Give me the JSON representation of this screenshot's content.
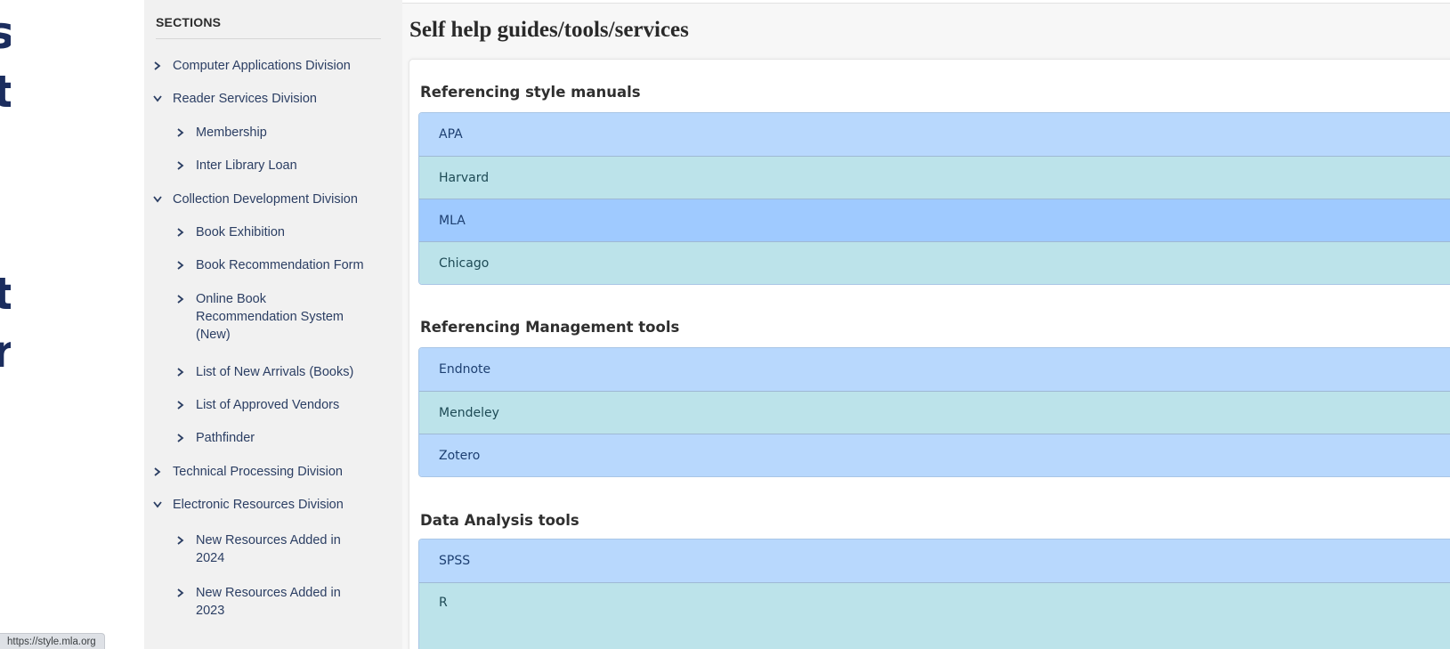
{
  "page": {
    "title": "Self help guides/tools/services"
  },
  "left_edge": {
    "glyphs": [
      "s",
      "t",
      "t",
      "r"
    ]
  },
  "sidebar": {
    "heading": "SECTIONS",
    "items": [
      {
        "label": "Computer Applications Division",
        "expanded": false,
        "level": 0
      },
      {
        "label": "Reader Services Division",
        "expanded": true,
        "level": 0
      },
      {
        "label": "Membership",
        "expanded": false,
        "level": 1
      },
      {
        "label": "Inter Library Loan",
        "expanded": false,
        "level": 1
      },
      {
        "label": "Collection Development Division",
        "expanded": true,
        "level": 0
      },
      {
        "label": "Book Exhibition",
        "expanded": false,
        "level": 1
      },
      {
        "label": "Book Recommendation Form",
        "expanded": false,
        "level": 1
      },
      {
        "label": "Online Book Recommendation System (New)",
        "expanded": false,
        "level": 1
      },
      {
        "label": "List of New Arrivals (Books)",
        "expanded": false,
        "level": 1
      },
      {
        "label": "List of Approved Vendors",
        "expanded": false,
        "level": 1
      },
      {
        "label": "Pathfinder",
        "expanded": false,
        "level": 1
      },
      {
        "label": "Technical Processing Division",
        "expanded": false,
        "level": 0
      },
      {
        "label": "Electronic Resources Division",
        "expanded": true,
        "level": 0
      },
      {
        "label": "New Resources Added in 2024",
        "expanded": false,
        "level": 1
      },
      {
        "label": "New Resources Added in 2023",
        "expanded": false,
        "level": 1
      }
    ]
  },
  "groups": [
    {
      "title": "Referencing style manuals",
      "items": [
        {
          "label": "APA",
          "style": "blue"
        },
        {
          "label": "Harvard",
          "style": "teal"
        },
        {
          "label": "MLA",
          "style": "active"
        },
        {
          "label": "Chicago",
          "style": "teal"
        }
      ]
    },
    {
      "title": "Referencing Management tools",
      "items": [
        {
          "label": "Endnote",
          "style": "blue"
        },
        {
          "label": "Mendeley",
          "style": "teal"
        },
        {
          "label": "Zotero",
          "style": "blue"
        }
      ]
    },
    {
      "title": "Data Analysis tools",
      "items": [
        {
          "label": "SPSS",
          "style": "blue"
        },
        {
          "label": "R",
          "style": "teal"
        }
      ]
    }
  ],
  "status_bar": {
    "url": "https://style.mla.org"
  },
  "colors": {
    "row_blue": "#b8d8fd",
    "row_teal": "#bce3ea",
    "row_active": "#9fcaff",
    "sidebar_bg": "#f1f1f1",
    "link_text": "#2b3e63"
  }
}
